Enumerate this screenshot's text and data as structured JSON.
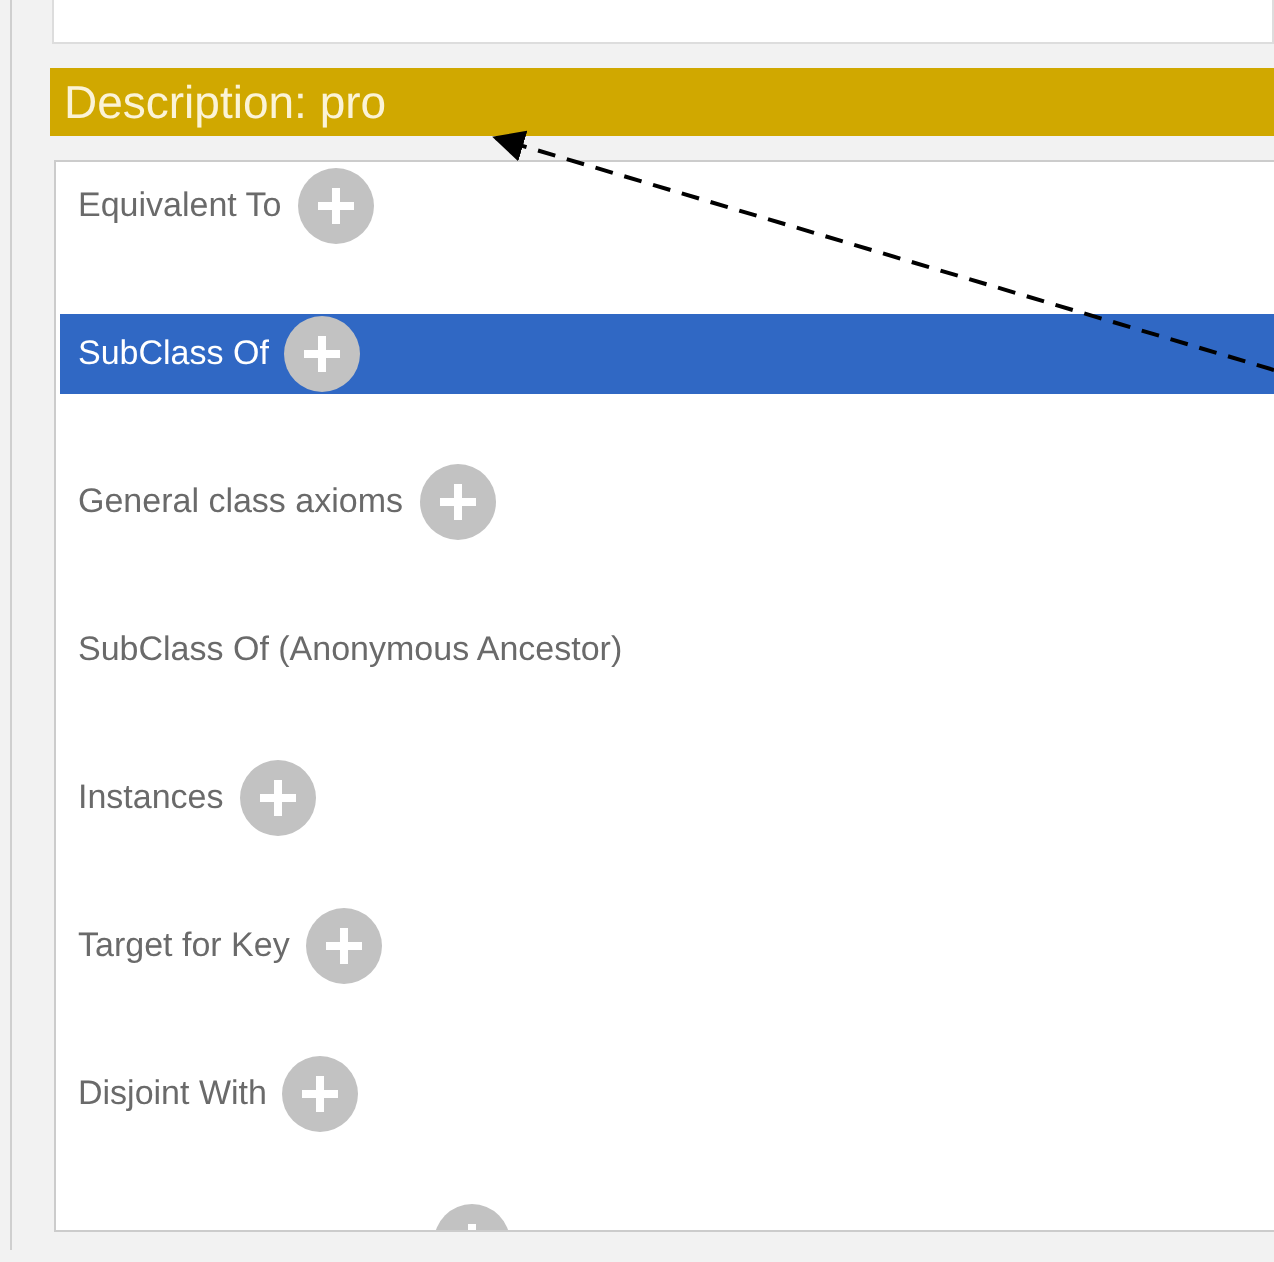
{
  "header": {
    "title": "Description: pro"
  },
  "sections": [
    {
      "label": "Equivalent To",
      "selected": false,
      "has_add": true
    },
    {
      "label": "SubClass Of",
      "selected": true,
      "has_add": true
    },
    {
      "label": "General class axioms",
      "selected": false,
      "has_add": true
    },
    {
      "label": "SubClass Of (Anonymous Ancestor)",
      "selected": false,
      "has_add": false
    },
    {
      "label": "Instances",
      "selected": false,
      "has_add": true
    },
    {
      "label": "Target for Key",
      "selected": false,
      "has_add": true
    },
    {
      "label": "Disjoint With",
      "selected": false,
      "has_add": true
    },
    {
      "selected": false,
      "has_add": true
    }
  ]
}
